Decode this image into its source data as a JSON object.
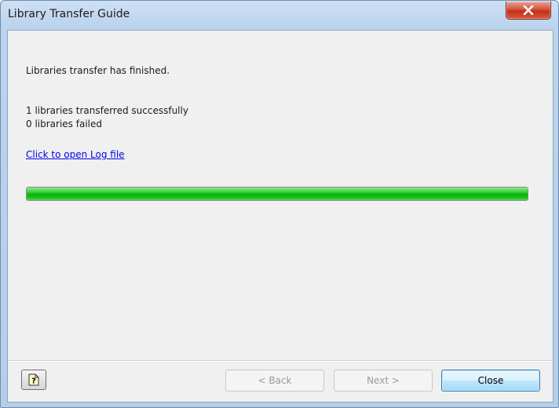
{
  "window": {
    "title": "Library Transfer Guide"
  },
  "content": {
    "status_message": "Libraries transfer has finished.",
    "success_text": "1 libraries transferred successfully",
    "failed_text": "0 libraries failed",
    "log_link": "Click to open Log file",
    "progress_percent": 100,
    "progress_color": "#0cb80c"
  },
  "footer": {
    "help_icon": "help-icon",
    "back_label": "< Back",
    "next_label": "Next >",
    "close_label": "Close"
  }
}
